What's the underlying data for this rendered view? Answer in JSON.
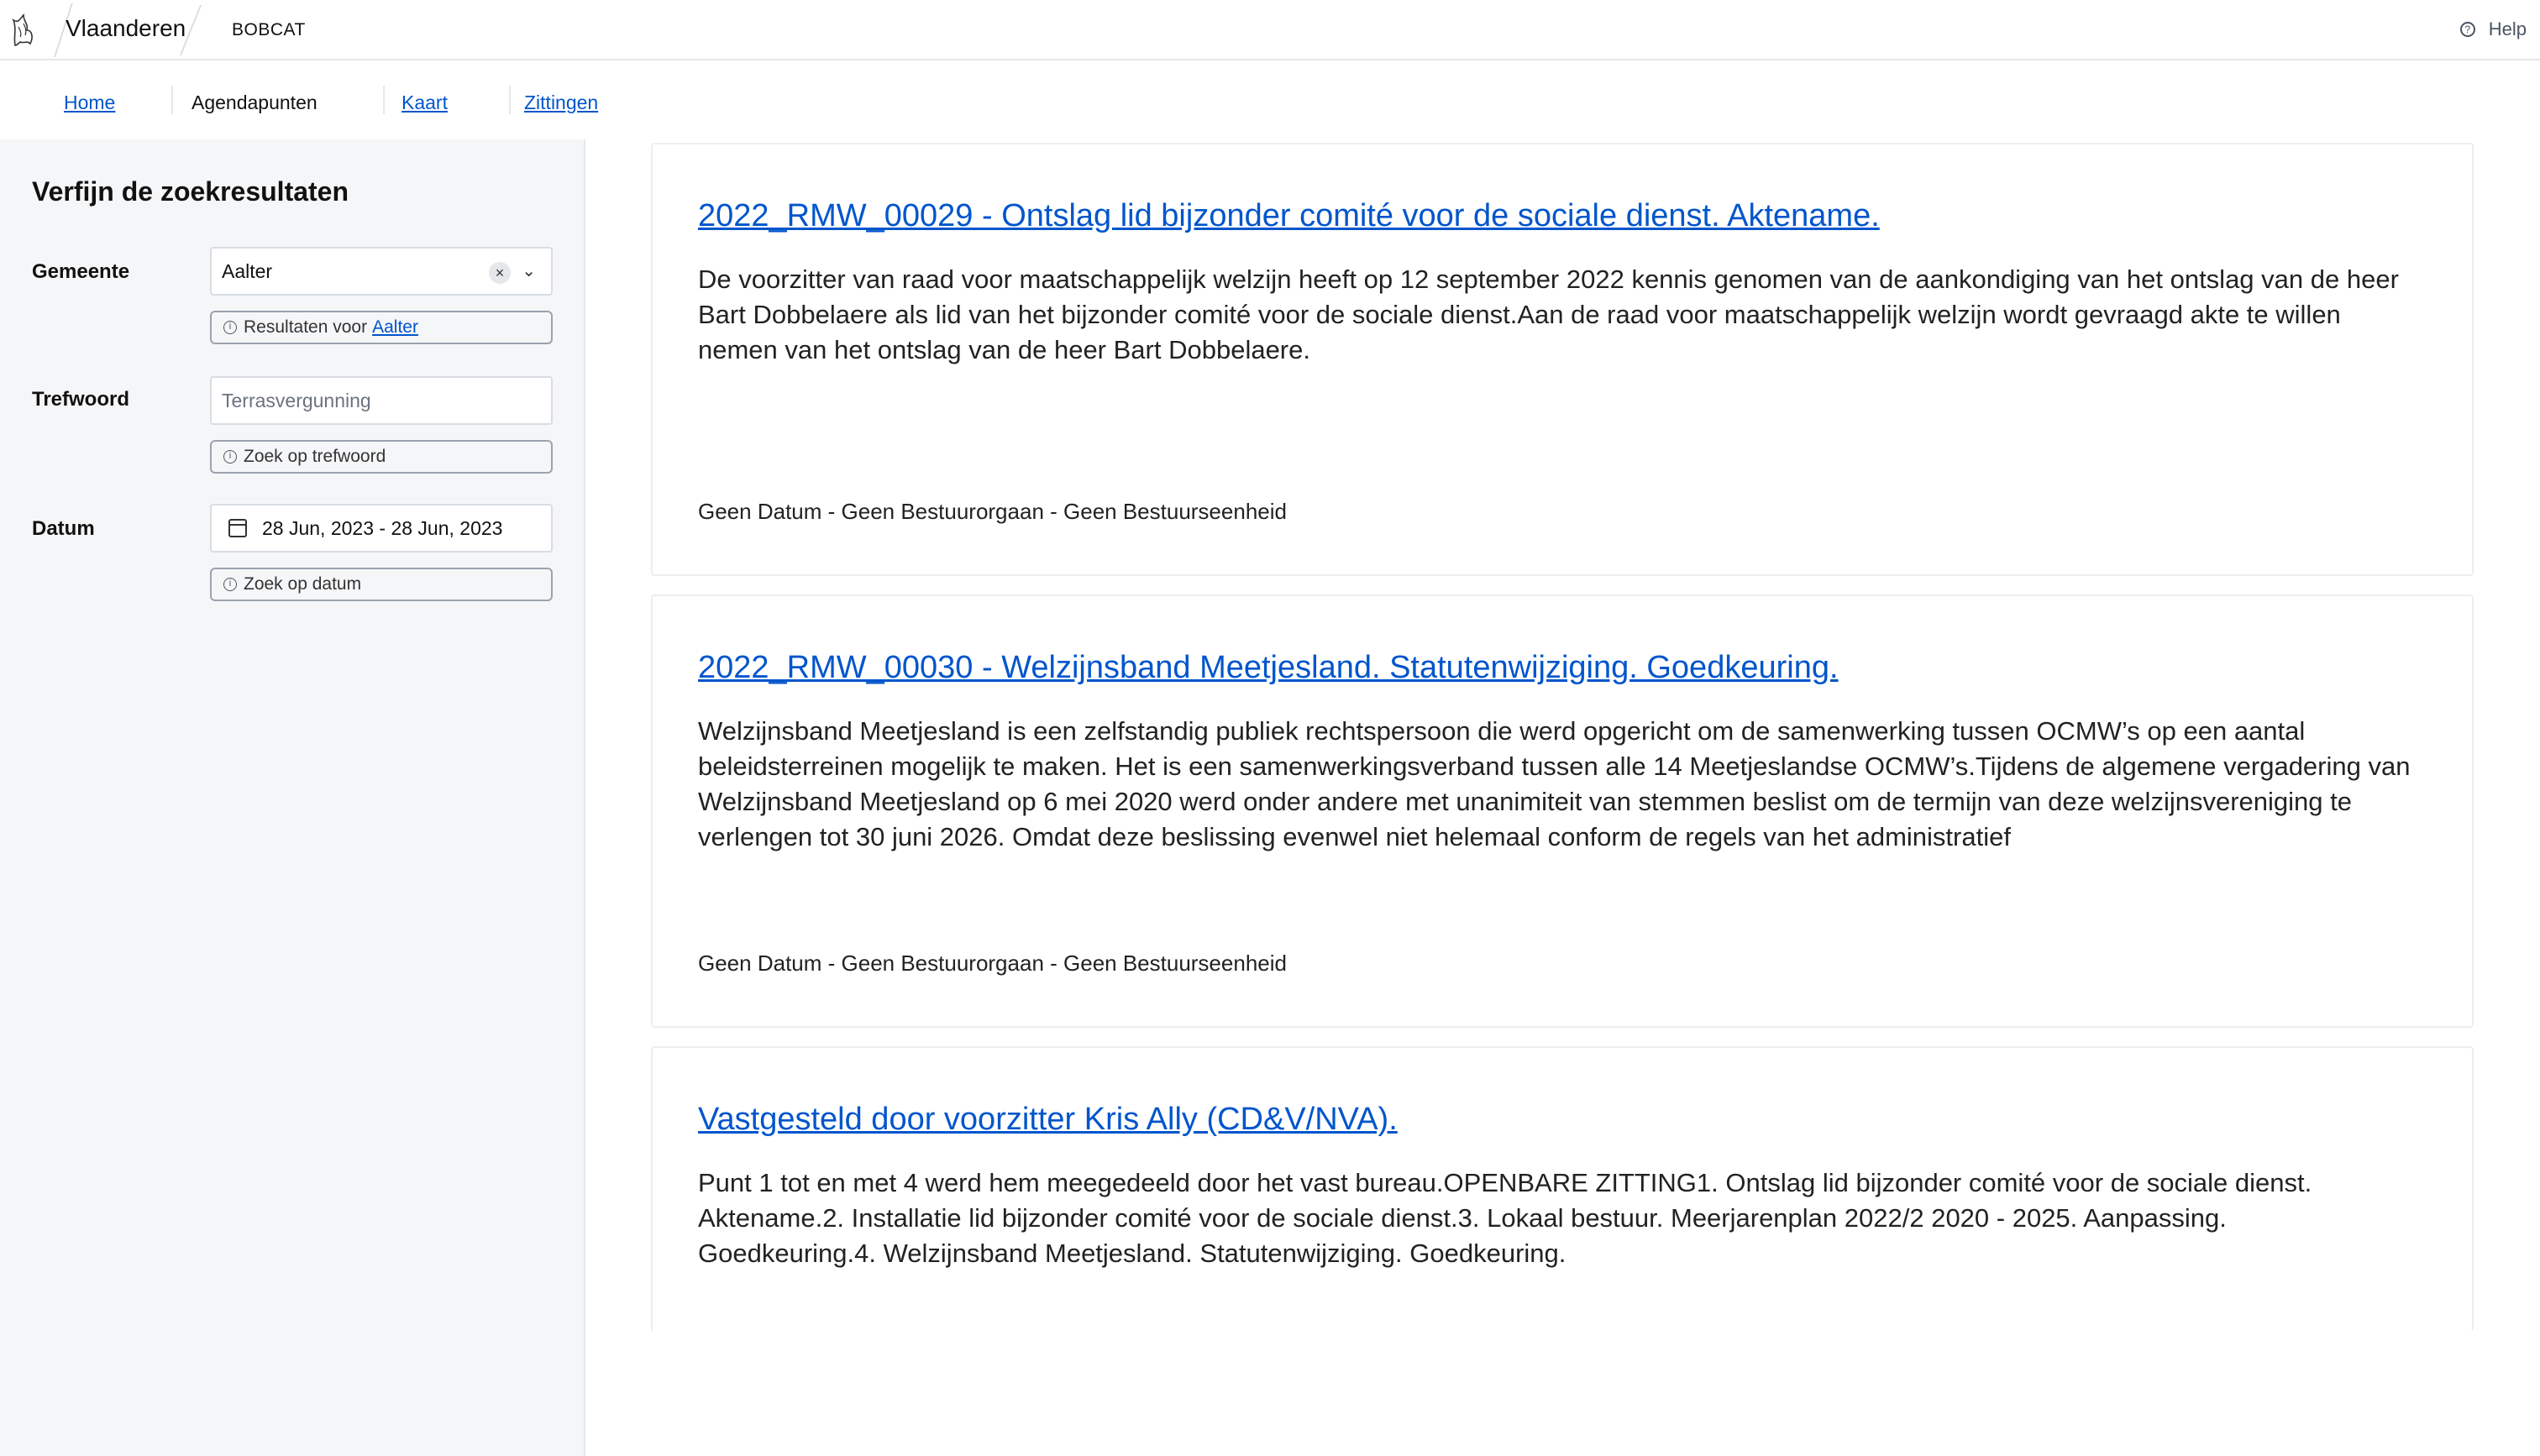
{
  "header": {
    "brand": "Vlaanderen",
    "app_name": "BOBCAT",
    "help_label": "Help"
  },
  "nav": {
    "items": [
      {
        "label": "Home",
        "active": false
      },
      {
        "label": "Agendapunten",
        "active": true
      },
      {
        "label": "Kaart",
        "active": false
      },
      {
        "label": "Zittingen",
        "active": false
      }
    ]
  },
  "sidebar": {
    "title": "Verfijn de zoekresultaten",
    "gemeente": {
      "label": "Gemeente",
      "value": "Aalter",
      "pill_text": "Resultaten voor",
      "pill_link": "Aalter"
    },
    "trefwoord": {
      "label": "Trefwoord",
      "placeholder": "Terrasvergunning",
      "pill_text": "Zoek op trefwoord"
    },
    "datum": {
      "label": "Datum",
      "value": "28 Jun, 2023 - 28 Jun, 2023",
      "pill_text": "Zoek op datum"
    }
  },
  "results": [
    {
      "title": "2022_RMW_00029 - Ontslag lid bijzonder comité voor de sociale dienst. Aktename.",
      "description": "De voorzitter van raad voor maatschappelijk welzijn heeft op 12 september 2022 kennis genomen van de aankondiging van het ontslag van de heer Bart Dobbelaere als lid van het bijzonder comité voor de sociale dienst.Aan de raad voor maatschappelijk welzijn wordt gevraagd akte te willen nemen van het ontslag van de heer Bart Dobbelaere.",
      "meta": "Geen Datum - Geen Bestuurorgaan - Geen Bestuurseenheid"
    },
    {
      "title": "2022_RMW_00030 - Welzijnsband Meetjesland. Statutenwijziging. Goedkeuring.",
      "description": "Welzijnsband Meetjesland is een zelfstandig publiek rechtspersoon die werd opgericht om de samenwerking tussen OCMW’s op een aantal beleidsterreinen mogelijk te maken. Het is een samenwerkingsverband tussen alle 14 Meetjeslandse OCMW’s.Tijdens de algemene vergadering van Welzijnsband Meetjesland op 6 mei 2020 werd onder andere met unanimiteit van stemmen beslist om de termijn van deze welzijnsvereniging te verlengen tot 30 juni 2026. Omdat deze beslissing evenwel niet helemaal conform de regels van het administratief",
      "meta": "Geen Datum - Geen Bestuurorgaan - Geen Bestuurseenheid"
    },
    {
      "title": "Vastgesteld door voorzitter Kris Ally (CD&V/NVA).",
      "description": "Punt 1 tot en met 4 werd hem meegedeeld door het vast bureau.OPENBARE ZITTING1. Ontslag lid bijzonder comité voor de sociale dienst. Aktename.2. Installatie lid bijzonder comité voor de sociale dienst.3. Lokaal bestuur. Meerjarenplan 2022/2 2020 - 2025. Aanpassing. Goedkeuring.4. Welzijnsband Meetjesland. Statutenwijziging. Goedkeuring.",
      "meta": ""
    }
  ]
}
